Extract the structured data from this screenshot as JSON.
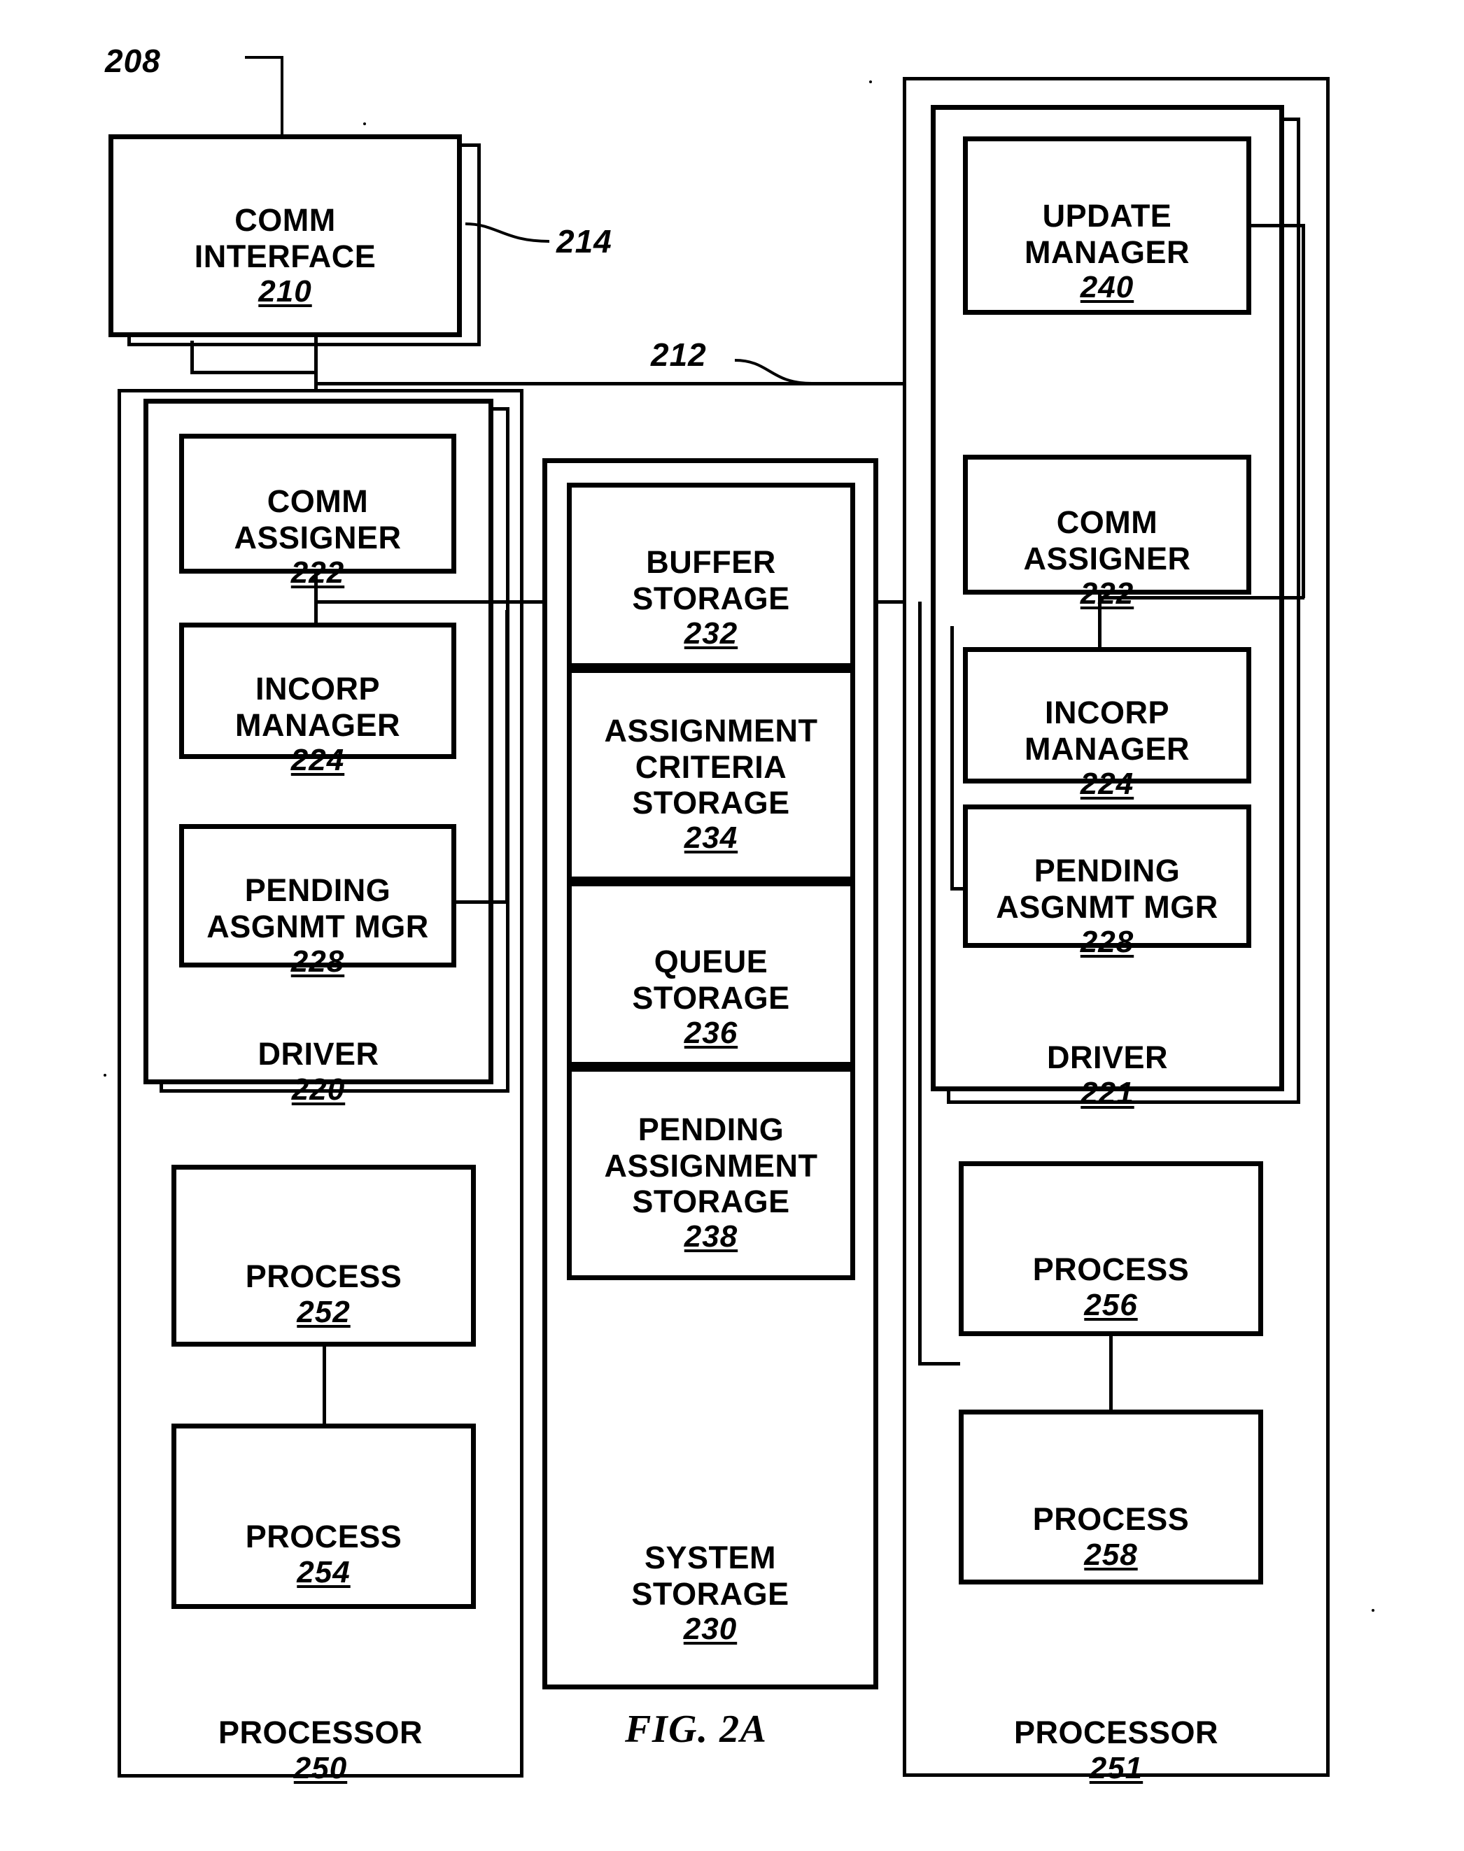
{
  "figure": {
    "caption": "FIG. 2A"
  },
  "reference_numerals": {
    "n208": "208",
    "n214": "214",
    "n212": "212"
  },
  "comm_interface": {
    "title": "COMM\nINTERFACE",
    "number": "210"
  },
  "left_processor": {
    "label": "PROCESSOR",
    "number": "250",
    "driver": {
      "label": "DRIVER",
      "number": "220",
      "modules": [
        {
          "title": "COMM\nASSIGNER",
          "number": "222"
        },
        {
          "title": "INCORP\nMANAGER",
          "number": "224"
        },
        {
          "title": "PENDING\nASGNMT MGR",
          "number": "228"
        }
      ]
    },
    "processes": [
      {
        "title": "PROCESS",
        "number": "252"
      },
      {
        "title": "PROCESS",
        "number": "254"
      }
    ]
  },
  "system_storage": {
    "label": "SYSTEM\nSTORAGE",
    "number": "230",
    "sections": [
      {
        "title": "BUFFER\nSTORAGE",
        "number": "232"
      },
      {
        "title": "ASSIGNMENT\nCRITERIA\nSTORAGE",
        "number": "234"
      },
      {
        "title": "QUEUE\nSTORAGE",
        "number": "236"
      },
      {
        "title": "PENDING\nASSIGNMENT\nSTORAGE",
        "number": "238"
      }
    ]
  },
  "right_processor": {
    "label": "PROCESSOR",
    "number": "251",
    "update_manager": {
      "title": "UPDATE\nMANAGER",
      "number": "240"
    },
    "driver": {
      "label": "DRIVER",
      "number": "221",
      "modules": [
        {
          "title": "COMM\nASSIGNER",
          "number": "222"
        },
        {
          "title": "INCORP\nMANAGER",
          "number": "224"
        },
        {
          "title": "PENDING\nASGNMT MGR",
          "number": "228"
        }
      ]
    },
    "processes": [
      {
        "title": "PROCESS",
        "number": "256"
      },
      {
        "title": "PROCESS",
        "number": "258"
      }
    ]
  }
}
